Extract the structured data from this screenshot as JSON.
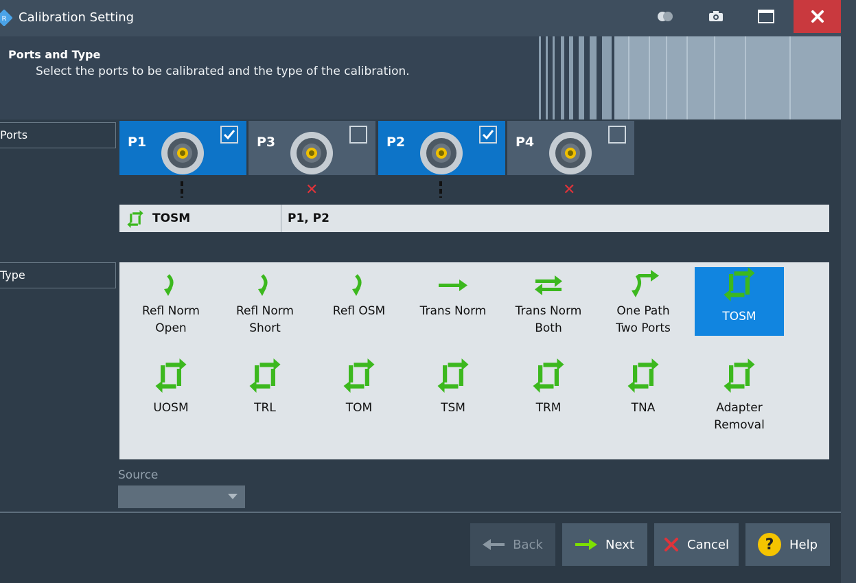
{
  "window": {
    "title": "Calibration Setting"
  },
  "header": {
    "title": "Ports and Type",
    "subtitle": "Select the ports to be calibrated and the type of the calibration."
  },
  "sections": {
    "ports_label": "Ports",
    "type_label": "Type"
  },
  "ports": [
    {
      "name": "P1",
      "checked": true
    },
    {
      "name": "P3",
      "checked": false
    },
    {
      "name": "P2",
      "checked": true
    },
    {
      "name": "P4",
      "checked": false
    }
  ],
  "summary": {
    "type": "TOSM",
    "ports": "P1, P2"
  },
  "types": [
    {
      "line1": "Refl Norm",
      "line2": "Open",
      "icon": "refl-open-icon",
      "selected": false
    },
    {
      "line1": "Refl Norm",
      "line2": "Short",
      "icon": "refl-short-icon",
      "selected": false
    },
    {
      "line1": "Refl OSM",
      "line2": "",
      "icon": "refl-osm-icon",
      "selected": false
    },
    {
      "line1": "Trans Norm",
      "line2": "",
      "icon": "trans-norm-icon",
      "selected": false
    },
    {
      "line1": "Trans Norm",
      "line2": "Both",
      "icon": "trans-both-icon",
      "selected": false
    },
    {
      "line1": "One Path",
      "line2": "Two Ports",
      "icon": "one-path-icon",
      "selected": false
    },
    {
      "line1": "TOSM",
      "line2": "",
      "icon": "two-port-cal-icon",
      "selected": true
    },
    {
      "line1": "UOSM",
      "line2": "",
      "icon": "two-port-cal-icon",
      "selected": false
    },
    {
      "line1": "TRL",
      "line2": "",
      "icon": "two-port-cal-icon",
      "selected": false
    },
    {
      "line1": "TOM",
      "line2": "",
      "icon": "two-port-cal-icon",
      "selected": false
    },
    {
      "line1": "TSM",
      "line2": "",
      "icon": "two-port-cal-icon",
      "selected": false
    },
    {
      "line1": "TRM",
      "line2": "",
      "icon": "two-port-cal-icon",
      "selected": false
    },
    {
      "line1": "TNA",
      "line2": "",
      "icon": "two-port-cal-icon",
      "selected": false
    },
    {
      "line1": "Adapter",
      "line2": "Removal",
      "icon": "two-port-cal-icon",
      "selected": false
    }
  ],
  "source": {
    "label": "Source",
    "value": ""
  },
  "buttons": {
    "back": "Back",
    "next": "Next",
    "cancel": "Cancel",
    "help": "Help"
  },
  "colors": {
    "accent": "#0d74c8",
    "green": "#3cb81e",
    "close": "#c9393e",
    "error": "#e0333a"
  }
}
